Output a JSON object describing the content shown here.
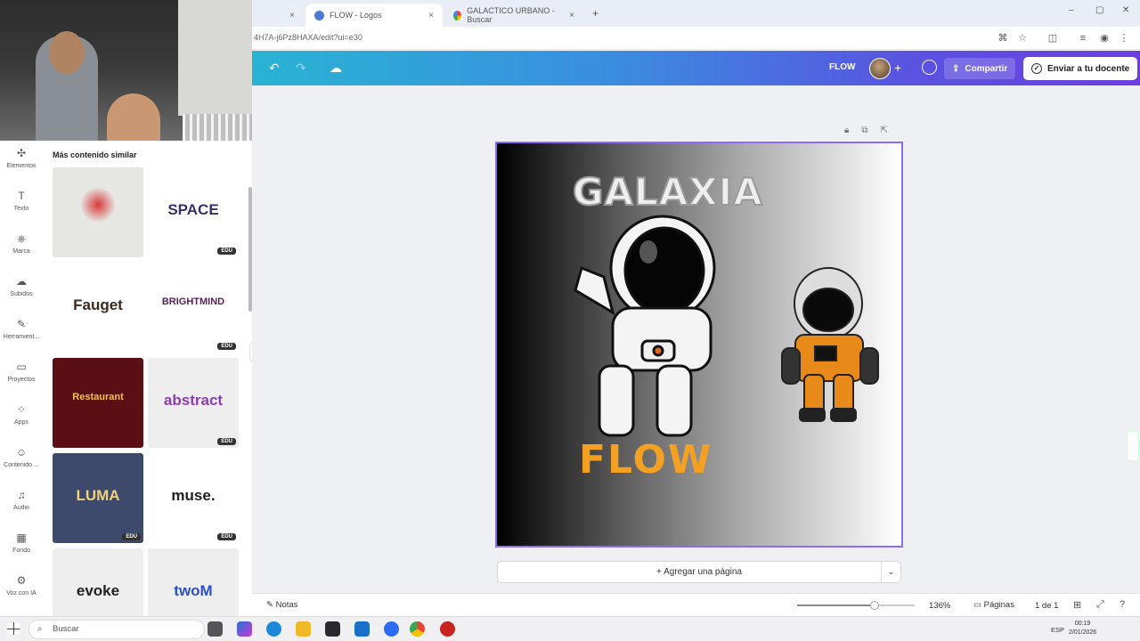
{
  "browser": {
    "tabs": [
      {
        "label": "",
        "close": "×"
      },
      {
        "label": "FLOW - Logos",
        "close": "×"
      },
      {
        "label": "GALACTICO URBANO - Buscar",
        "close": "×"
      }
    ],
    "new_tab": "+",
    "url": "4H7A-j6Pz8HAXA/edit?ui=e30"
  },
  "toolbar": {
    "design_title": "FLOW",
    "share_label": "Compartir",
    "send_label": "Enviar a tu docente"
  },
  "sidenav": [
    {
      "label": "Elementos",
      "icon": "elements-icon"
    },
    {
      "label": "Texto",
      "icon": "text-icon"
    },
    {
      "label": "Marca",
      "icon": "brand-icon"
    },
    {
      "label": "Subidos",
      "icon": "upload-icon"
    },
    {
      "label": "Herramient...",
      "icon": "tools-icon"
    },
    {
      "label": "Proyectos",
      "icon": "folder-icon"
    },
    {
      "label": "Apps",
      "icon": "apps-icon"
    },
    {
      "label": "Contenido ...",
      "icon": "content-icon"
    },
    {
      "label": "Audio",
      "icon": "audio-icon"
    },
    {
      "label": "Fondo",
      "icon": "background-icon"
    },
    {
      "label": "Voz con IA",
      "icon": "ai-voice-icon"
    }
  ],
  "panel": {
    "title": "Más contenido similar",
    "edu_badge": "EDU",
    "thumbnails": [
      {
        "text": "",
        "bg": "#e6e6e3",
        "color": "#d93a3a",
        "edu": false
      },
      {
        "text": "SPACE",
        "bg": "#ffffff",
        "color": "#3b2f6a",
        "edu": true
      },
      {
        "text": "Fauget",
        "bg": "#ffffff",
        "color": "#3a2a1e",
        "edu": false
      },
      {
        "text": "BRIGHTMIND",
        "bg": "#ffffff",
        "color": "#5a1f5a",
        "edu": true
      },
      {
        "text": "Restaurant",
        "bg": "#5a0f14",
        "color": "#f2c14a",
        "edu": false
      },
      {
        "text": "abstract",
        "bg": "#eeeeee",
        "color": "#8a3fae",
        "edu": true
      },
      {
        "text": "LUMA",
        "bg": "#3e4a6b",
        "color": "#f0d27a",
        "edu": true
      },
      {
        "text": "muse.",
        "bg": "#ffffff",
        "color": "#222222",
        "edu": true
      },
      {
        "text": "evoke",
        "bg": "#eeeeee",
        "color": "#222222",
        "edu": false
      },
      {
        "text": "twoM",
        "bg": "#eeeeee",
        "color": "#2b4fc9",
        "edu": false
      }
    ]
  },
  "canvas": {
    "headline": "GALAXIA",
    "brand": "FLOW",
    "add_page_label": "+ Agregar una página",
    "brand_color": "#f4a023",
    "selection_color": "#8b6cf5"
  },
  "bottombar": {
    "notes_label": "Notas",
    "zoom_label": "136%",
    "zoom_fraction": 0.66,
    "pages_label": "Páginas",
    "page_indicator": "1 de 1"
  },
  "taskbar": {
    "search_placeholder": "Buscar",
    "lang": "ESP",
    "time": "00:19",
    "date": "2/01/2026"
  }
}
